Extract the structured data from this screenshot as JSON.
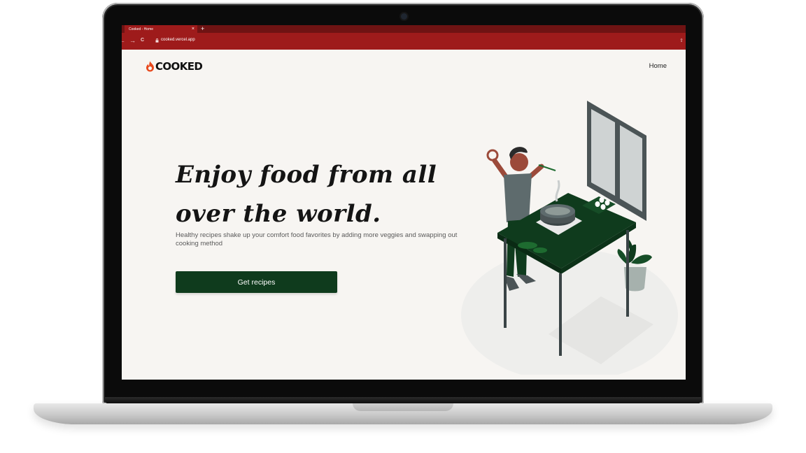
{
  "browser": {
    "tab_title": "Cooked - Home",
    "tab_close": "×",
    "new_tab": "+",
    "back": "←",
    "forward": "→",
    "reload": "C",
    "url": "cooked.vercel.app",
    "share": "⇪"
  },
  "site": {
    "logo_text": "COOKED",
    "nav_home": "Home",
    "hero_title": "Enjoy food from all over the world.",
    "hero_subtitle": "Healthy recipes shake up your comfort food favorites by adding more veggies and swapping out cooking method",
    "cta_label": "Get recipes"
  },
  "colors": {
    "browser_red": "#9e1b1b",
    "brand_green": "#0f3b1d",
    "logo_flame": "#e8491d",
    "page_background": "#f7f5f2"
  },
  "icons": [
    "flame-icon",
    "lock-icon",
    "back-arrow-icon",
    "forward-arrow-icon",
    "reload-icon",
    "share-icon"
  ]
}
